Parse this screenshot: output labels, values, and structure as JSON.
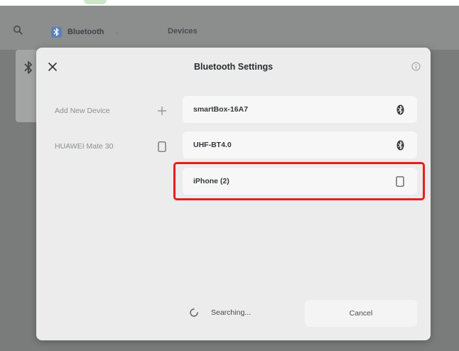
{
  "topbar": {
    "search_icon": "search-icon",
    "bluetooth_tab": {
      "label": "Bluetooth",
      "icon": "bluetooth-icon"
    },
    "devices_tab": {
      "label": "Devices"
    }
  },
  "modal": {
    "title": "Bluetooth Settings",
    "close_icon": "close-icon",
    "info_icon": "info-icon",
    "left_items": [
      {
        "label": "Add New Device",
        "icon": "plus-icon"
      },
      {
        "label": "HUAWEI Mate 30",
        "icon": "phone-icon"
      }
    ],
    "devices": [
      {
        "name": "smartBox-16A7",
        "icon": "bluetooth-icon"
      },
      {
        "name": "UHF-BT4.0",
        "icon": "bluetooth-icon"
      },
      {
        "name": "iPhone (2)",
        "icon": "phone-icon"
      }
    ],
    "status": {
      "label": "Searching...",
      "icon": "spinner-icon"
    },
    "cancel_label": "Cancel"
  },
  "colors": {
    "highlight": "#e3201b",
    "modal_bg": "#ececec",
    "row_bg": "#f7f7f7"
  }
}
